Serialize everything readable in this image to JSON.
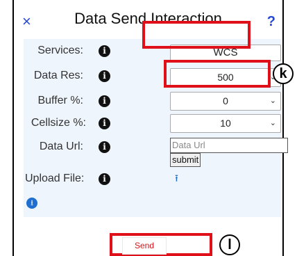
{
  "dialog": {
    "title": "Data Send Interaction",
    "close_glyph": "×",
    "help_glyph": "?"
  },
  "form": {
    "services": {
      "label": "Services:",
      "value": "WCS"
    },
    "data_res": {
      "label": "Data Res:",
      "value": "500"
    },
    "buffer": {
      "label": "Buffer %:",
      "value": "0"
    },
    "cellsize": {
      "label": "Cellsize %:",
      "value": "10"
    },
    "data_url": {
      "label": "Data Url:",
      "placeholder": "Data Url",
      "submit_label": "submit"
    },
    "upload_file": {
      "label": "Upload File:"
    },
    "info_glyph": "i"
  },
  "send": {
    "label": "Send"
  },
  "annotations": {
    "k": "k",
    "l": "l"
  },
  "icons": {
    "close": "close-icon",
    "help": "help-icon",
    "info": "info-icon",
    "upload": "upload-icon",
    "download": "download-icon",
    "dropdown": "chevron-down-icon"
  },
  "colors": {
    "accent": "#2747d6",
    "highlight": "#e0101a",
    "panel": "#eef5fc",
    "link_blue": "#1f6fd1"
  }
}
